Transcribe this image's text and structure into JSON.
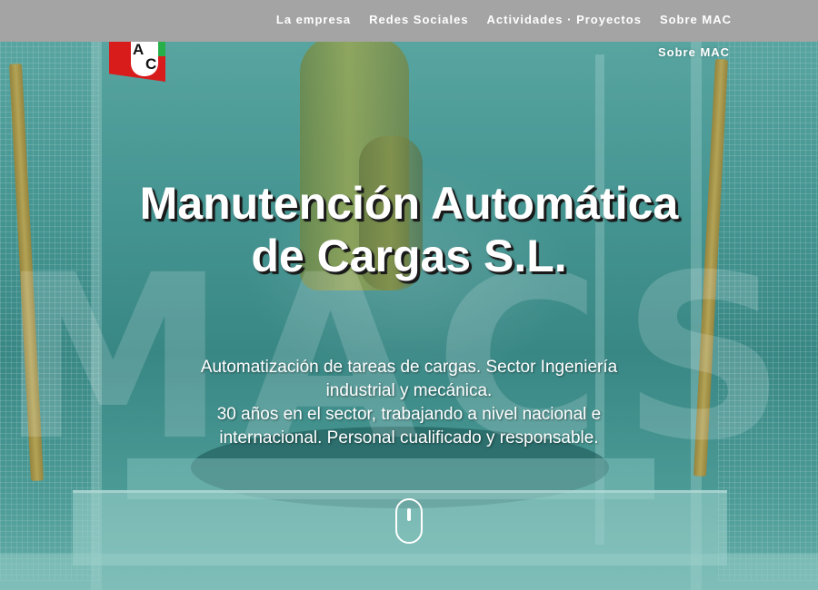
{
  "nav": {
    "items": [
      {
        "label": "La empresa"
      },
      {
        "label": "Redes Sociales"
      },
      {
        "label": "Actividades · Proyectos"
      },
      {
        "label": "Sobre MAC"
      }
    ],
    "duplicate_label": "Sobre MAC"
  },
  "logo": {
    "letter_top": "A",
    "letter_bottom": "C"
  },
  "hero": {
    "title": "Manutención Automática de Cargas S.L.",
    "subtitle_lines": [
      "Automatización de tareas de cargas. Sector Ingeniería industrial y mecánica.",
      "30 años en el sector, trabajando a nivel nacional e internacional. Personal cualificado y responsable."
    ],
    "watermark": "MACS.L."
  },
  "colors": {
    "navbar_bg": "#a4a4a4",
    "hero_tint": "#4f9f9b",
    "logo_red": "#d81c1c",
    "logo_green": "#27b04a"
  },
  "icons": {
    "scroll": "mouse-scroll-icon"
  }
}
